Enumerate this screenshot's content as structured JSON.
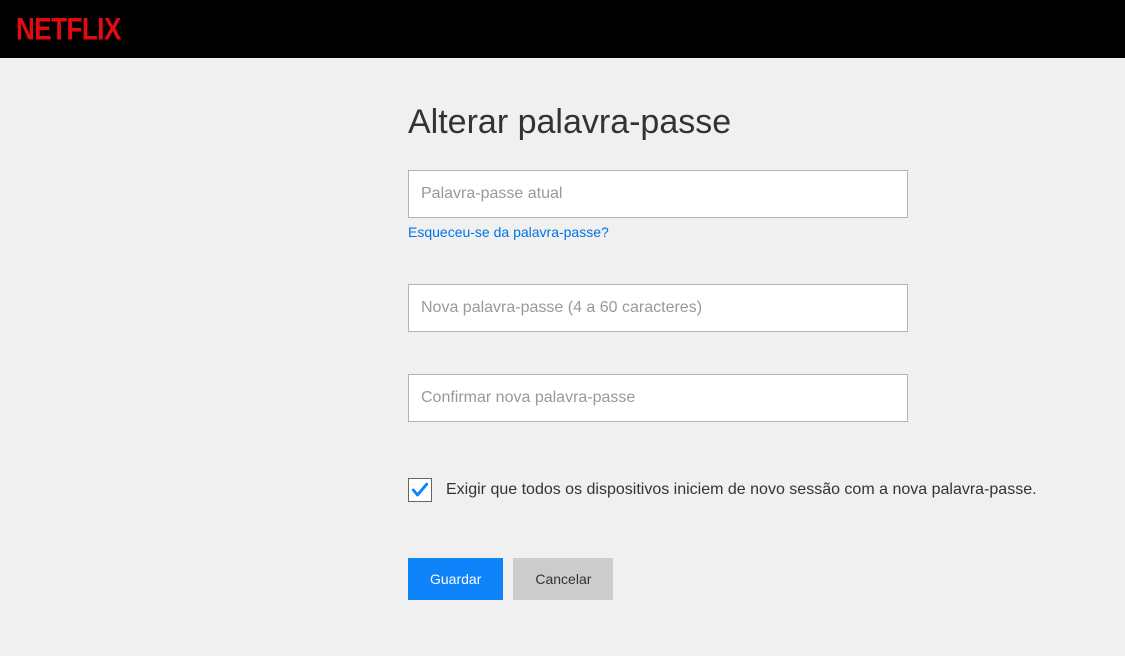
{
  "header": {
    "logo": "NETFLIX"
  },
  "page": {
    "title": "Alterar palavra-passe"
  },
  "form": {
    "current_password": {
      "placeholder": "Palavra-passe atual"
    },
    "forgot_link": "Esqueceu-se da palavra-passe?",
    "new_password": {
      "placeholder": "Nova palavra-passe (4 a 60 caracteres)"
    },
    "confirm_password": {
      "placeholder": "Confirmar nova palavra-passe"
    },
    "checkbox": {
      "checked": true,
      "label": "Exigir que todos os dispositivos iniciem de novo sessão com a nova palavra-passe."
    },
    "buttons": {
      "save": "Guardar",
      "cancel": "Cancelar"
    }
  }
}
